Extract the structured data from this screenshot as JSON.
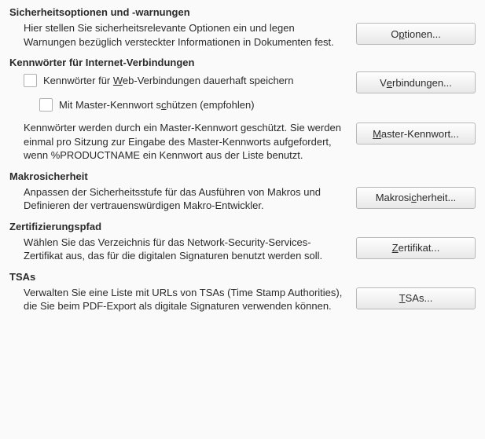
{
  "sections": {
    "security": {
      "title": "Sicherheitsoptionen und -warnungen",
      "desc": "Hier stellen Sie sicherheitsrelevante Optionen ein und legen Warnungen bezüglich versteckter Informationen in Dokumenten fest.",
      "button_pre": "O",
      "button_ul": "p",
      "button_post": "tionen..."
    },
    "passwords": {
      "title": "Kennwörter für Internet-Verbindungen",
      "cb1_pre": "Kennwörter für ",
      "cb1_ul": "W",
      "cb1_post": "eb-Verbindungen dauerhaft speichern",
      "btn1_pre": "V",
      "btn1_ul": "e",
      "btn1_post": "rbindungen...",
      "cb2_pre": "Mit Master-Kennwort s",
      "cb2_ul": "c",
      "cb2_post": "hützen (empfohlen)",
      "desc": "Kennwörter werden durch ein Master-Kennwort geschützt. Sie werden einmal pro Sitzung zur Eingabe des Master-Kennworts aufgefordert, wenn %PRODUCTNAME ein Kennwort aus der Liste benutzt.",
      "btn2_pre": "",
      "btn2_ul": "M",
      "btn2_post": "aster-Kennwort..."
    },
    "macro": {
      "title": "Makrosicherheit",
      "desc": "Anpassen der Sicherheitsstufe für das Ausführen von Makros und Definieren der vertrauenswürdigen Makro-Entwickler.",
      "btn_pre": "Makrosi",
      "btn_ul": "c",
      "btn_post": "herheit..."
    },
    "cert": {
      "title": "Zertifizierungspfad",
      "desc": "Wählen Sie das Verzeichnis für das Network-Security-Services-Zertifikat aus, das für die digitalen Signaturen benutzt werden soll.",
      "btn_pre": "",
      "btn_ul": "Z",
      "btn_post": "ertifikat..."
    },
    "tsa": {
      "title": "TSAs",
      "desc": "Verwalten Sie eine Liste mit URLs von TSAs (Time Stamp Authorities), die Sie beim PDF-Export als digitale Signaturen verwenden können.",
      "btn_pre": "",
      "btn_ul": "T",
      "btn_post": "SAs..."
    }
  }
}
